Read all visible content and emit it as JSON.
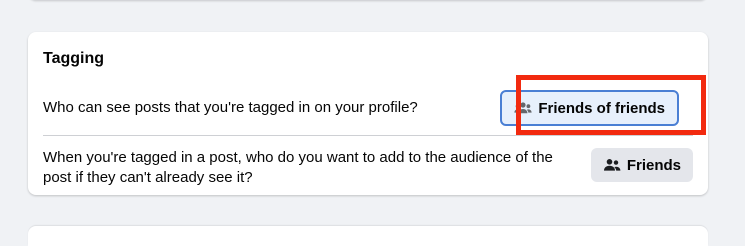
{
  "section": {
    "title": "Tagging"
  },
  "settings": [
    {
      "question": "Who can see posts that you're tagged in on your profile?",
      "value_label": "Friends of friends",
      "icon": "friends-of-friends-icon"
    },
    {
      "question": "When you're tagged in a post, who do you want to add to the audience of the post if they can't already see it?",
      "value_label": "Friends",
      "icon": "friends-icon"
    }
  ],
  "colors": {
    "page_background": "#f0f2f5",
    "card_background": "#ffffff",
    "button_background": "#e4e6eb",
    "selected_button_background": "#e7f0fc",
    "selected_button_border": "#4a7fd4",
    "highlight_outline": "#f22a0f"
  }
}
